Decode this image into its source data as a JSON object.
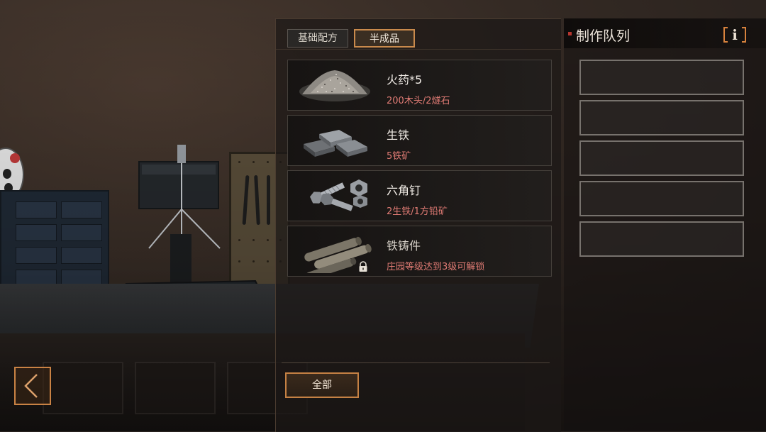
{
  "tabs": [
    {
      "label": "基础配方",
      "active": false
    },
    {
      "label": "半成品",
      "active": true
    }
  ],
  "recipes": [
    {
      "name": "火药*5",
      "requirement": "200木头/2燧石",
      "icon": "gunpowder-pile-icon",
      "locked": false
    },
    {
      "name": "生铁",
      "requirement": "5铁矿",
      "icon": "iron-ingots-icon",
      "locked": false
    },
    {
      "name": "六角钉",
      "requirement": "2生铁/1方铅矿",
      "icon": "hex-bolts-icon",
      "locked": false
    },
    {
      "name": "铁铸件",
      "requirement": "庄园等级达到3级可解锁",
      "icon": "iron-castings-icon",
      "locked": true
    }
  ],
  "filter_button": {
    "label": "全部"
  },
  "queue": {
    "title": "制作队列",
    "info_label": "i",
    "slot_count": 5
  },
  "colors": {
    "accent": "#c98a4c",
    "requirement_text": "#e07b74",
    "queue_marker": "#b5352e"
  }
}
